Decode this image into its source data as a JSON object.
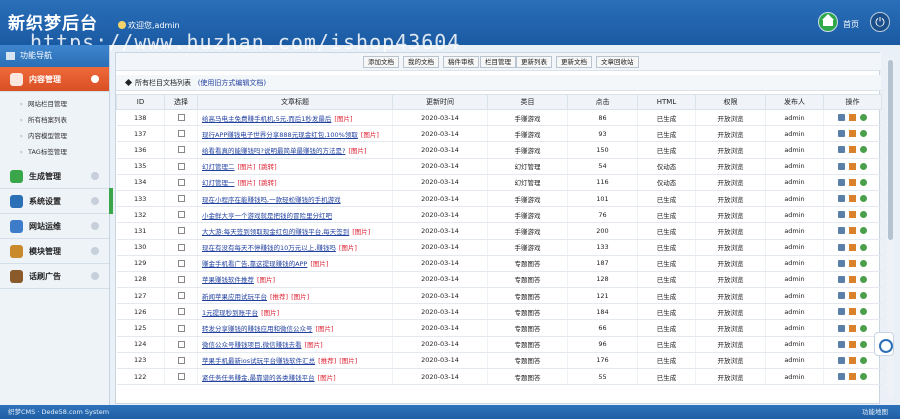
{
  "header": {
    "logo": "新织梦后台",
    "welcome": "欢迎您,admin",
    "home_label": "首页"
  },
  "watermark": "https://www.huzhan.com/ishop43604",
  "sidebar": {
    "head": "功能导航",
    "active": "内容管理",
    "sub_items": [
      "网站栏目管理",
      "所有档案列表",
      "内容模型管理",
      "TAG标签管理"
    ],
    "items": [
      {
        "label": "生成管理",
        "color": "#3aa64a"
      },
      {
        "label": "系统设置",
        "color": "#2b6fb6"
      },
      {
        "label": "网站运维",
        "color": "#3d7cc9"
      },
      {
        "label": "模块管理",
        "color": "#c98a2b"
      },
      {
        "label": "话刷广告",
        "color": "#8b5a2b"
      }
    ]
  },
  "toolbar": [
    "添加文档",
    "我的文档",
    "稿件审核",
    "栏目管理",
    "更新列表",
    "更新文档",
    "文章回收站"
  ],
  "list": {
    "title": "所有栏目文档列表",
    "hint": "(使用旧方式编辑文档)"
  },
  "columns": [
    "ID",
    "选择",
    "文章标题",
    "更新时间",
    "类目",
    "点击",
    "HTML",
    "权限",
    "发布人",
    "操作"
  ],
  "rows": [
    {
      "id": "138",
      "title": "给高马电主免费赚手机机,5元,而后1秒发最后",
      "tags": [
        "图片"
      ],
      "date": "2020-03-14",
      "cat": "手赚游戏",
      "clicks": "86",
      "html": "已生成",
      "perm": "开放浏览",
      "author": "admin"
    },
    {
      "id": "137",
      "title": "现行APP赚钱电子世界分享888元现金红包,100%领取",
      "tags": [
        "图片"
      ],
      "date": "2020-03-14",
      "cat": "手赚游戏",
      "clicks": "93",
      "html": "已生成",
      "perm": "开放浏览",
      "author": "admin"
    },
    {
      "id": "136",
      "title": "给看看真的能赚钱吗?说明最简单最赚钱的方法是?",
      "tags": [
        "图片"
      ],
      "date": "2020-03-14",
      "cat": "手赚游戏",
      "clicks": "150",
      "html": "已生成",
      "perm": "开放浏览",
      "author": "admin"
    },
    {
      "id": "135",
      "title": "幻灯管理二",
      "tags": [
        "图片",
        "跳转"
      ],
      "date": "2020-03-14",
      "cat": "幻灯管理",
      "clicks": "54",
      "html": "仅动态",
      "perm": "开放浏览",
      "author": "admin"
    },
    {
      "id": "134",
      "title": "幻灯管理一",
      "tags": [
        "图片",
        "跳转"
      ],
      "date": "2020-03-14",
      "cat": "幻灯管理",
      "clicks": "116",
      "html": "仅动态",
      "perm": "开放浏览",
      "author": "admin"
    },
    {
      "id": "133",
      "title": "现在小程序在能赚钱吗,一款轻松赚钱的手机游戏",
      "tags": [],
      "date": "2020-03-14",
      "cat": "手赚游戏",
      "clicks": "101",
      "html": "已生成",
      "perm": "开放浏览",
      "author": "admin"
    },
    {
      "id": "132",
      "title": "小金鲜大亨一个游戏就是把钱的冒险里分红吧",
      "tags": [],
      "date": "2020-03-14",
      "cat": "手赚游戏",
      "clicks": "76",
      "html": "已生成",
      "perm": "开放浏览",
      "author": "admin"
    },
    {
      "id": "131",
      "title": "大大游:每天签到领取现金红包的赚钱平台,每天签到",
      "tags": [
        "图片"
      ],
      "date": "2020-03-14",
      "cat": "手赚游戏",
      "clicks": "200",
      "html": "已生成",
      "perm": "开放浏览",
      "author": "admin"
    },
    {
      "id": "130",
      "title": "现在有没有每天不停赚钱的10万元以上,赚钱吗",
      "tags": [
        "图片"
      ],
      "date": "2020-03-14",
      "cat": "手赚游戏",
      "clicks": "133",
      "html": "已生成",
      "perm": "开放浏览",
      "author": "admin"
    },
    {
      "id": "129",
      "title": "赚金手机看广告,靠这提现赚钱的APP",
      "tags": [
        "图片"
      ],
      "date": "2020-03-14",
      "cat": "专题图答",
      "clicks": "187",
      "html": "已生成",
      "perm": "开放浏览",
      "author": "admin"
    },
    {
      "id": "128",
      "title": "苹果赚钱软件推荐",
      "tags": [
        "图片"
      ],
      "date": "2020-03-14",
      "cat": "专题图答",
      "clicks": "128",
      "html": "已生成",
      "perm": "开放浏览",
      "author": "admin"
    },
    {
      "id": "127",
      "title": "新闻苹果应用试玩平台",
      "tags": [
        "推荐",
        "图片"
      ],
      "date": "2020-03-14",
      "cat": "专题图答",
      "clicks": "121",
      "html": "已生成",
      "perm": "开放浏览",
      "author": "admin"
    },
    {
      "id": "126",
      "title": "1元提现秒到账平台",
      "tags": [
        "图片"
      ],
      "date": "2020-03-14",
      "cat": "专题图答",
      "clicks": "184",
      "html": "已生成",
      "perm": "开放浏览",
      "author": "admin"
    },
    {
      "id": "125",
      "title": "转发分享赚钱的赚钱应用和微信公众号",
      "tags": [
        "图片"
      ],
      "date": "2020-03-14",
      "cat": "专题图答",
      "clicks": "66",
      "html": "已生成",
      "perm": "开放浏览",
      "author": "admin"
    },
    {
      "id": "124",
      "title": "微信公众号赚钱项目,微信赚钱去看",
      "tags": [
        "图片"
      ],
      "date": "2020-03-14",
      "cat": "专题图答",
      "clicks": "96",
      "html": "已生成",
      "perm": "开放浏览",
      "author": "admin"
    },
    {
      "id": "123",
      "title": "苹果手机最新ios试玩平台赚钱软件汇总",
      "tags": [
        "推荐",
        "图片"
      ],
      "date": "2020-03-14",
      "cat": "专题图答",
      "clicks": "176",
      "html": "已生成",
      "perm": "开放浏览",
      "author": "admin"
    },
    {
      "id": "122",
      "title": "紧任务任务赚金,最靠谱的各类赚钱平台",
      "tags": [
        "图片"
      ],
      "date": "2020-03-14",
      "cat": "专题图答",
      "clicks": "55",
      "html": "已生成",
      "perm": "开放浏览",
      "author": "admin"
    }
  ],
  "footer": {
    "left": "织梦CMS · Dede58.com System",
    "right": "功能地图"
  }
}
